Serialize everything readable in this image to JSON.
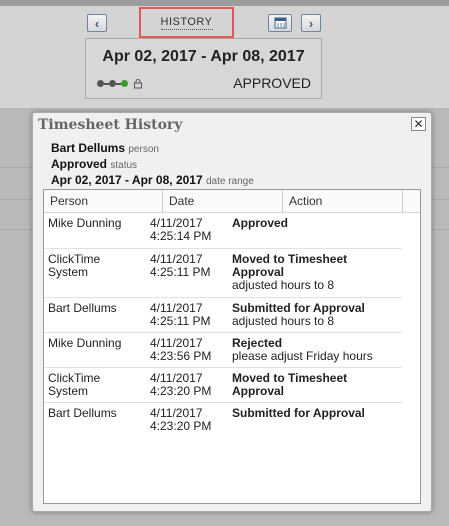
{
  "header": {
    "history_label": "HISTORY",
    "prev_icon": "‹",
    "next_icon": "›",
    "date_range": "Apr 02, 2017 - Apr 08, 2017",
    "status": "APPROVED"
  },
  "dialog": {
    "title": "Timesheet History",
    "close_label": "✕",
    "person_value": "Bart Dellums",
    "person_label": "person",
    "status_value": "Approved",
    "status_label": "status",
    "range_value": "Apr 02, 2017 - Apr 08, 2017",
    "range_label": "date range"
  },
  "table": {
    "columns": [
      "Person",
      "Date",
      "Action"
    ],
    "rows": [
      {
        "person": "Mike Dunning",
        "date": "4/11/2017",
        "time": "4:25:14 PM",
        "action": "Approved",
        "note": ""
      },
      {
        "person": "ClickTime System",
        "date": "4/11/2017",
        "time": "4:25:11 PM",
        "action": "Moved to Timesheet Approval",
        "note": "adjusted hours to 8"
      },
      {
        "person": "Bart Dellums",
        "date": "4/11/2017",
        "time": "4:25:11 PM",
        "action": "Submitted for Approval",
        "note": "adjusted hours to 8"
      },
      {
        "person": "Mike Dunning",
        "date": "4/11/2017",
        "time": "4:23:56 PM",
        "action": "Rejected",
        "note": "please adjust Friday hours"
      },
      {
        "person": "ClickTime System",
        "date": "4/11/2017",
        "time": "4:23:20 PM",
        "action": "Moved to Timesheet Approval",
        "note": ""
      },
      {
        "person": "Bart Dellums",
        "date": "4/11/2017",
        "time": "4:23:20 PM",
        "action": "Submitted for Approval",
        "note": ""
      }
    ]
  }
}
